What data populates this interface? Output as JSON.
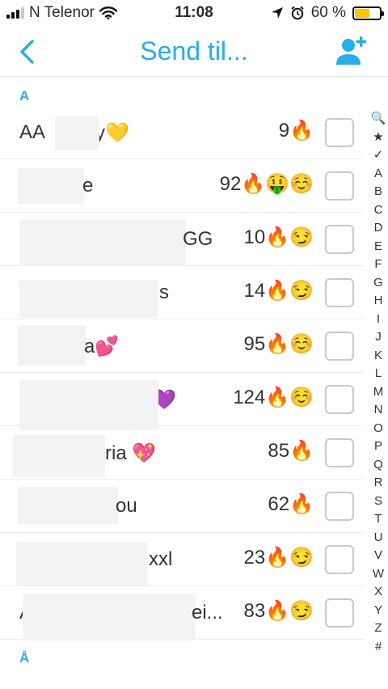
{
  "status_bar": {
    "carrier": "N Telenor",
    "time": "11:08",
    "battery": "60 %",
    "battery_level": 0.6
  },
  "nav": {
    "title": "Send til...",
    "back_icon": "chevron-left-icon",
    "add_icon": "add-friend-icon"
  },
  "sections": {
    "a": "A",
    "aa": "Å"
  },
  "contacts": [
    {
      "name": "AA",
      "name2": "y💛",
      "score": "9🔥"
    },
    {
      "name": "e",
      "score": "92🔥🤑☺️"
    },
    {
      "name": "GG",
      "score": "10🔥😏"
    },
    {
      "name": "s",
      "score": "14🔥😏"
    },
    {
      "name": "a💕",
      "score": "95🔥☺️"
    },
    {
      "name": "💜",
      "score": "124🔥☺️"
    },
    {
      "name": "ria 💖",
      "score": "85🔥"
    },
    {
      "name": "ou",
      "score": "62🔥"
    },
    {
      "name": "xxl",
      "score": "23🔥😏"
    },
    {
      "name": "A",
      "name2": "ei...",
      "score": "83🔥😏"
    }
  ],
  "index_letters": [
    "🔍",
    "★",
    "✓",
    "A",
    "B",
    "C",
    "D",
    "E",
    "F",
    "G",
    "H",
    "I",
    "J",
    "K",
    "L",
    "M",
    "N",
    "O",
    "P",
    "Q",
    "R",
    "S",
    "T",
    "U",
    "V",
    "W",
    "X",
    "Y",
    "Z",
    "#"
  ],
  "colors": {
    "accent": "#27aee8",
    "battery": "#f7c600"
  }
}
